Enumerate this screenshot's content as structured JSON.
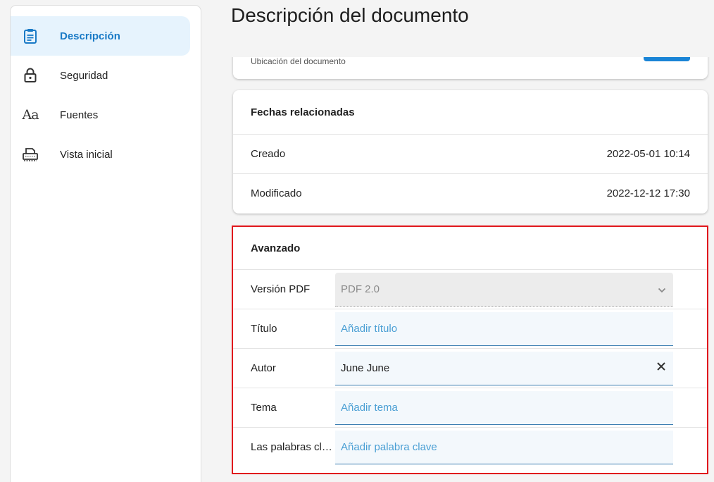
{
  "page_title": "Descripción del documento",
  "sidebar": {
    "items": [
      {
        "label": "Descripción",
        "icon": "clipboard-icon",
        "active": true
      },
      {
        "label": "Seguridad",
        "icon": "lock-icon",
        "active": false
      },
      {
        "label": "Fuentes",
        "icon": "font-aa-icon",
        "active": false
      },
      {
        "label": "Vista inicial",
        "icon": "printer-icon",
        "active": false
      }
    ],
    "fonts_glyph": "Aa"
  },
  "location": {
    "label": "Ubicación del documento"
  },
  "dates": {
    "header": "Fechas relacionadas",
    "rows": [
      {
        "key": "Creado",
        "value": "2022-05-01 10:14"
      },
      {
        "key": "Modificado",
        "value": "2022-12-12 17:30"
      }
    ]
  },
  "advanced": {
    "header": "Avanzado",
    "pdf_version": {
      "label": "Versión PDF",
      "value": "PDF 2.0"
    },
    "title": {
      "label": "Título",
      "placeholder": "Añadir título"
    },
    "author": {
      "label": "Autor",
      "value": "June June"
    },
    "subject": {
      "label": "Tema",
      "placeholder": "Añadir tema"
    },
    "keywords": {
      "label": "Las palabras clave",
      "placeholder": "Añadir palabra clave"
    }
  },
  "colors": {
    "accent": "#1a7ac6",
    "highlight_border": "#e0171c",
    "active_bg": "#e6f3fd"
  }
}
